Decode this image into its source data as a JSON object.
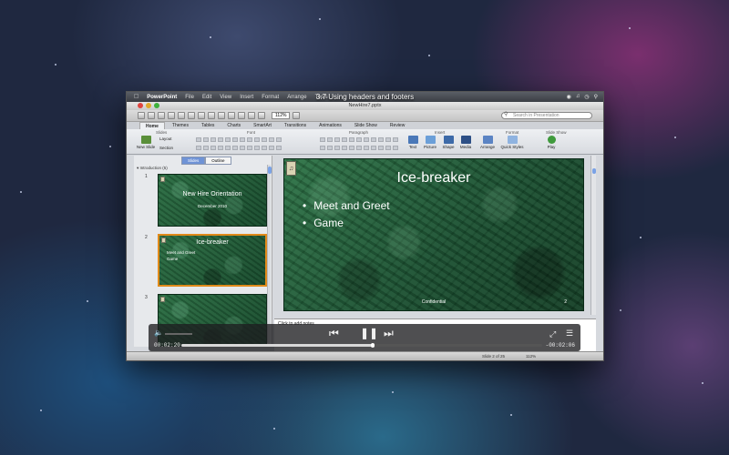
{
  "video": {
    "title": "3.7 Using headers and footers",
    "elapsed": "00:02:20",
    "remaining": "-00:02:06",
    "progress": 0.53
  },
  "menubar": {
    "app": "PowerPoint",
    "items": [
      "File",
      "Edit",
      "View",
      "Insert",
      "Format",
      "Arrange",
      "Tools"
    ]
  },
  "window": {
    "title": "NewHire7.pptx",
    "zoom": "112%"
  },
  "search": {
    "placeholder": "Search in Presentation"
  },
  "ribbon": {
    "tabs": [
      "Home",
      "Themes",
      "Tables",
      "Charts",
      "SmartArt",
      "Transitions",
      "Animations",
      "Slide Show",
      "Review"
    ],
    "groups": {
      "slides": "Slides",
      "font": "Font",
      "paragraph": "Paragraph",
      "insert": "Insert",
      "format": "Format",
      "slideshow": "Slide Show"
    },
    "new_slide": "New Slide",
    "layout": "Layout",
    "section": "Section",
    "insert_items": [
      "Text",
      "Picture",
      "Shape",
      "Media",
      "Arrange",
      "Quick Styles",
      "Play"
    ]
  },
  "sidebar": {
    "tabs": [
      "Slides",
      "Outline"
    ],
    "section": "Introduction (5)",
    "slides": [
      {
        "num": "1",
        "title": "New Hire Orientation",
        "subtitle": "December 2010"
      },
      {
        "num": "2",
        "title": "Ice-breaker",
        "bullets": [
          "Meet and Greet",
          "Game"
        ]
      },
      {
        "num": "3"
      }
    ]
  },
  "slide": {
    "title": "Ice-breaker",
    "bullets": [
      "Meet and Greet",
      "Game"
    ],
    "footer": "Confidential",
    "page_number": "2"
  },
  "notes": {
    "placeholder": "Click to add notes"
  },
  "status": {
    "view": "Normal View",
    "slide_of": "Slide 2 of 25",
    "zoom": "112%"
  },
  "colors": {
    "slide_green": "#1f5a37",
    "selection": "#e08a1a",
    "accent": "#6f93d6"
  }
}
